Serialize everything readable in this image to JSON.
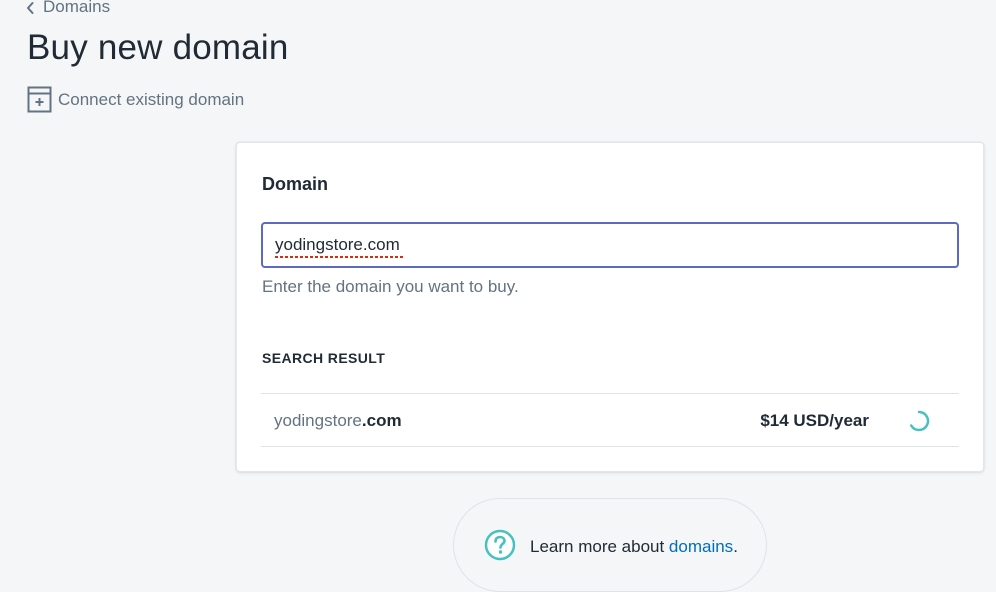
{
  "breadcrumb": {
    "label": "Domains"
  },
  "page": {
    "title": "Buy new domain"
  },
  "actions": {
    "connect_existing": "Connect existing domain"
  },
  "card": {
    "title": "Domain",
    "input": {
      "value": "yodingstore.com",
      "placeholder": ""
    },
    "help_text": "Enter the domain you want to buy.",
    "search_heading": "SEARCH RESULT",
    "results": [
      {
        "name": "yodingstore",
        "tld": ".com",
        "price": "$14 USD/year",
        "status": "loading"
      }
    ]
  },
  "footer": {
    "prefix": "Learn more about ",
    "link": "domains",
    "suffix": "."
  },
  "colors": {
    "accent": "#5c6ac4",
    "link": "#006fbb",
    "help_icon": "#47c1bf",
    "spinner": "#47c1bf"
  },
  "icons": {
    "back": "chevron-left-icon",
    "connect": "domain-connect-icon",
    "spinner": "loading-spinner-icon",
    "help": "question-circle-icon"
  }
}
